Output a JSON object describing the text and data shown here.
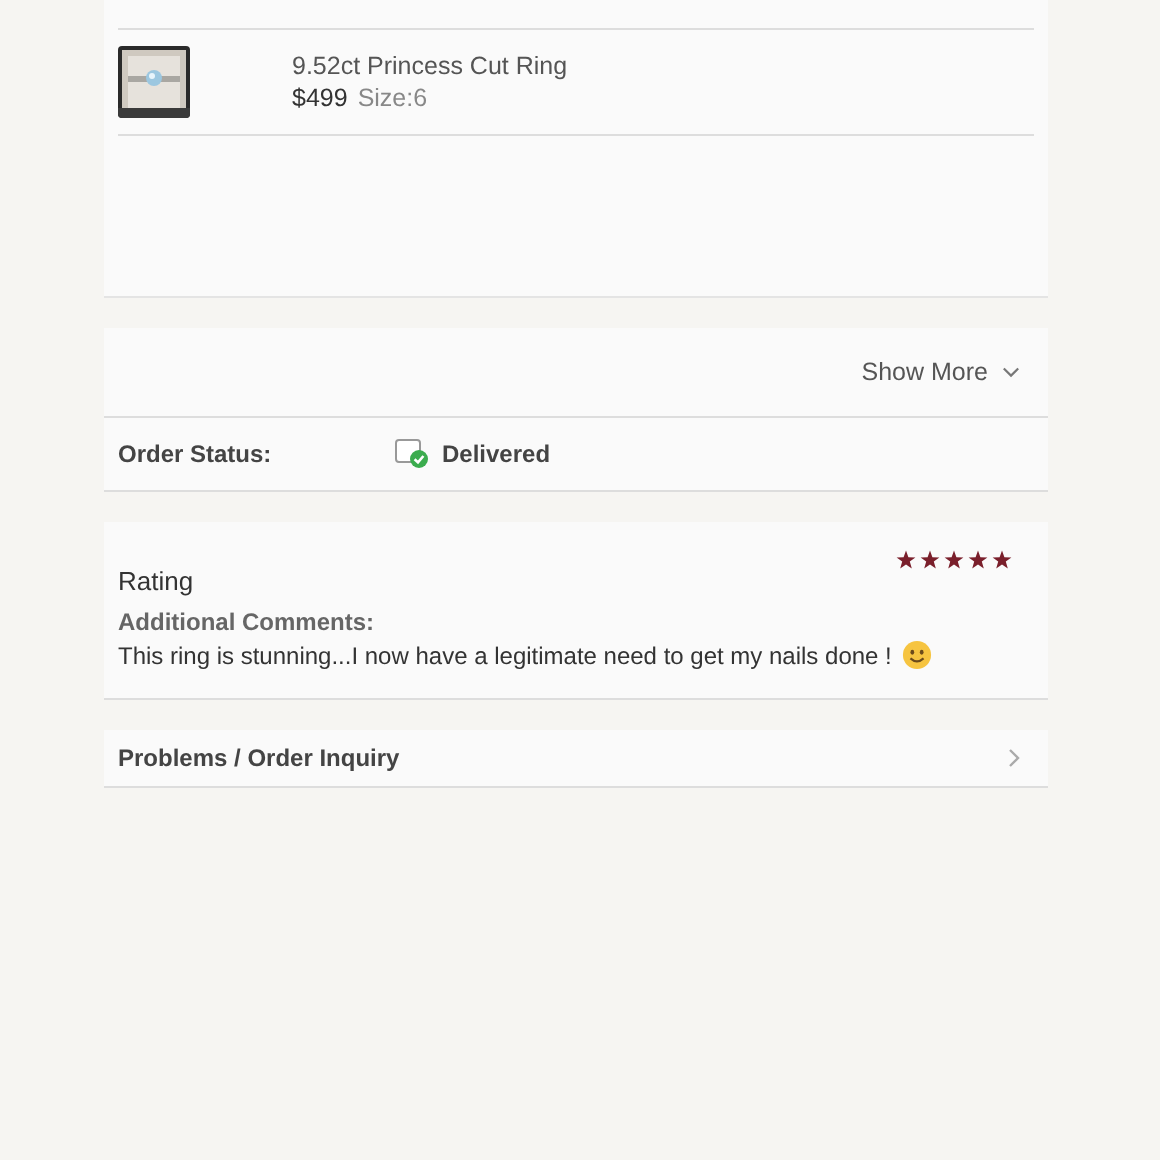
{
  "order_item": {
    "kind": "picture",
    "name": "9.52ct Princess Cut Ring",
    "price": "$499",
    "size": "Size:6"
  },
  "details": {
    "toggle": "Show More"
  },
  "order_status": {
    "label": "Order Status:",
    "value": "Delivered"
  },
  "rating": {
    "title": "Rating",
    "stars": 5,
    "comments_label": "Additional Comments:",
    "comment": "This ring is stunning...I now have a legitimate need to get my nails done !"
  },
  "links": [
    "Problems / Order Inquiry"
  ]
}
